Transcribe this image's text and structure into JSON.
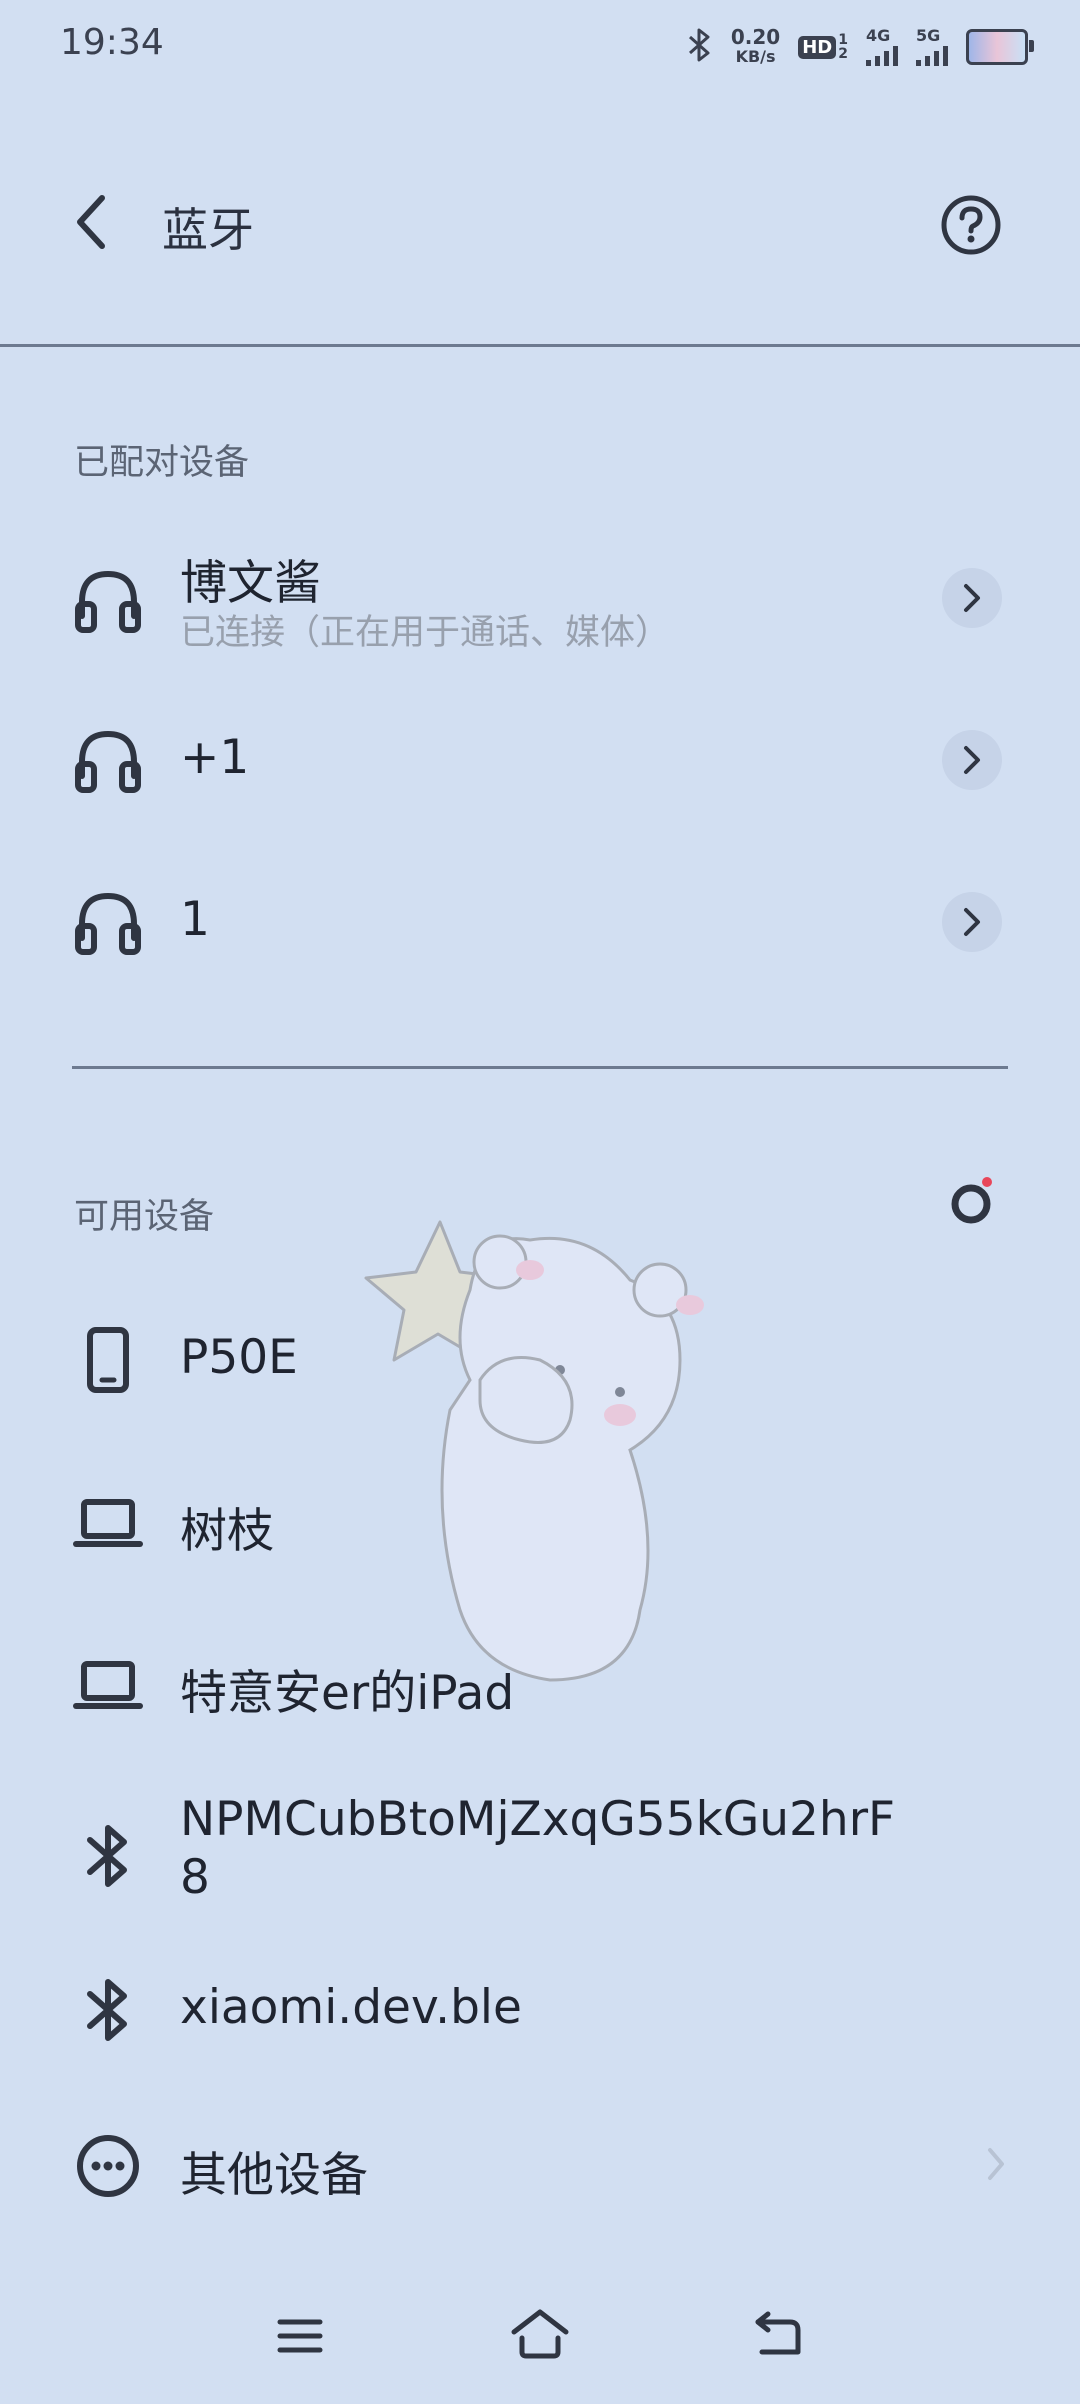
{
  "status_bar": {
    "time": "19:34",
    "net_speed_value": "0.20",
    "net_speed_unit": "KB/s",
    "hd_label": "HD",
    "hd_sub_top": "1",
    "hd_sub_bottom": "2",
    "net_4g": "4G",
    "net_5g": "5G"
  },
  "header": {
    "title": "蓝牙"
  },
  "paired": {
    "label": "已配对设备",
    "devices": [
      {
        "name": "博文酱",
        "status": "已连接（正在用于通话、媒体）",
        "icon": "headphones-icon"
      },
      {
        "name": "+1",
        "icon": "headphones-icon"
      },
      {
        "name": "1",
        "icon": "headphones-icon"
      }
    ]
  },
  "available": {
    "label": "可用设备",
    "devices": [
      {
        "name": "P50E",
        "icon": "phone-icon"
      },
      {
        "name": "树枝",
        "icon": "laptop-icon"
      },
      {
        "name": "特意安er的iPad",
        "icon": "laptop-icon"
      },
      {
        "name_line1": "NPMCubBtoMjZxqG55kGu2hrF",
        "name_line2": "8",
        "icon": "bluetooth-icon"
      },
      {
        "name": "xiaomi.dev.ble",
        "icon": "bluetooth-icon"
      },
      {
        "name": "其他设备",
        "icon": "more-dots-icon"
      }
    ]
  },
  "colors": {
    "background": "#d2dff2",
    "accent_dot": "#e8465a",
    "icon": "#2f3542"
  }
}
